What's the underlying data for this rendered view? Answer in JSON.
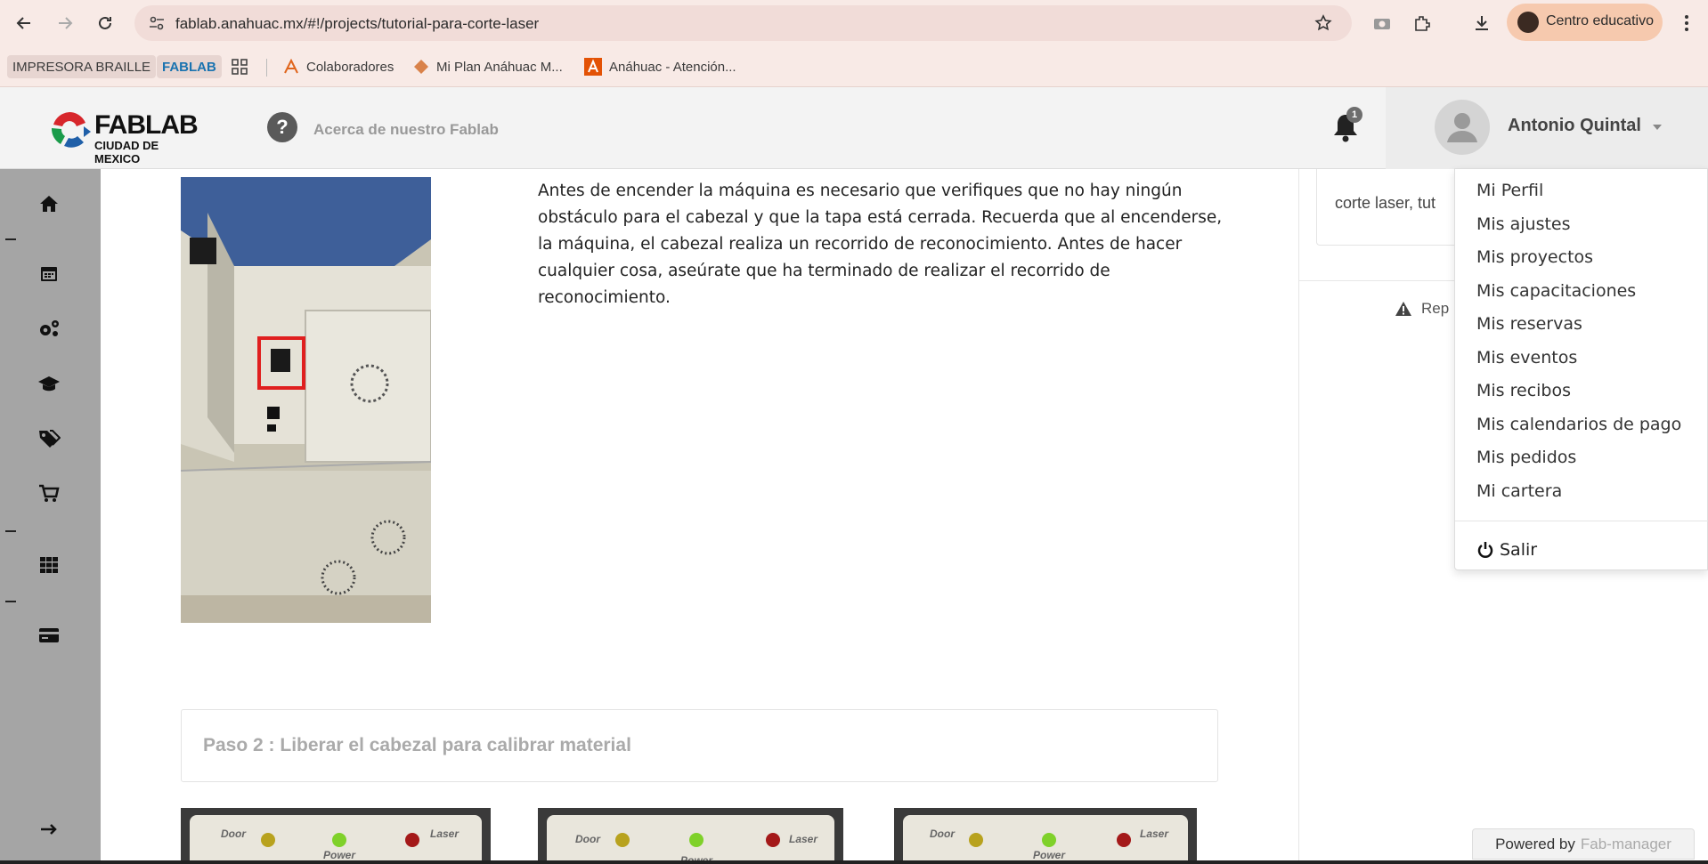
{
  "browser": {
    "url": "fablab.anahuac.mx/#!/projects/tutorial-para-corte-laser",
    "profile_label": "Centro educativo"
  },
  "bookmarks": [
    {
      "label": "IMPRESORA BRAILLE"
    },
    {
      "label": "FABLAB"
    },
    {
      "label": "Colaboradores"
    },
    {
      "label": "Mi Plan Anáhuac M..."
    },
    {
      "label": "Anáhuac - Atención..."
    }
  ],
  "header": {
    "logo_text": "FABLAB",
    "logo_sub": "CIUDAD DE MEXICO",
    "about_label": "Acerca de nuestro Fablab",
    "notification_count": "1",
    "user_name": "Antonio Quintal"
  },
  "main": {
    "step_text": "Antes de encender la máquina es necesario que verifiques que no hay ningún obstáculo para el cabezal y que la tapa está cerrada. Recuerda que al encenderse, la máquina, el cabezal realiza un recorrido de reconocimiento. Antes de hacer cualquier cosa, aseúrate que ha terminado de realizar el recorrido de reconocimiento.",
    "step2_title": "Paso 2 : Liberar el cabezal para calibrar material",
    "panel_labels": {
      "door": "Door",
      "power": "Power",
      "laser": "Laser"
    }
  },
  "right": {
    "tags_text": "corte laser, tut",
    "report_label": "Rep"
  },
  "user_menu": {
    "items": [
      "Mi Perfil",
      "Mis ajustes",
      "Mis proyectos",
      "Mis capacitaciones",
      "Mis reservas",
      "Mis eventos",
      "Mis recibos",
      "Mis calendarios de pago",
      "Mis pedidos",
      "Mi cartera"
    ],
    "logout": "Salir"
  },
  "footer": {
    "powered_by": "Powered by",
    "powered_link": "Fab-manager"
  },
  "colors": {
    "sidebar": "#a5a5a5",
    "browser_chrome": "#f8eae6",
    "header": "#f3f3f3"
  }
}
